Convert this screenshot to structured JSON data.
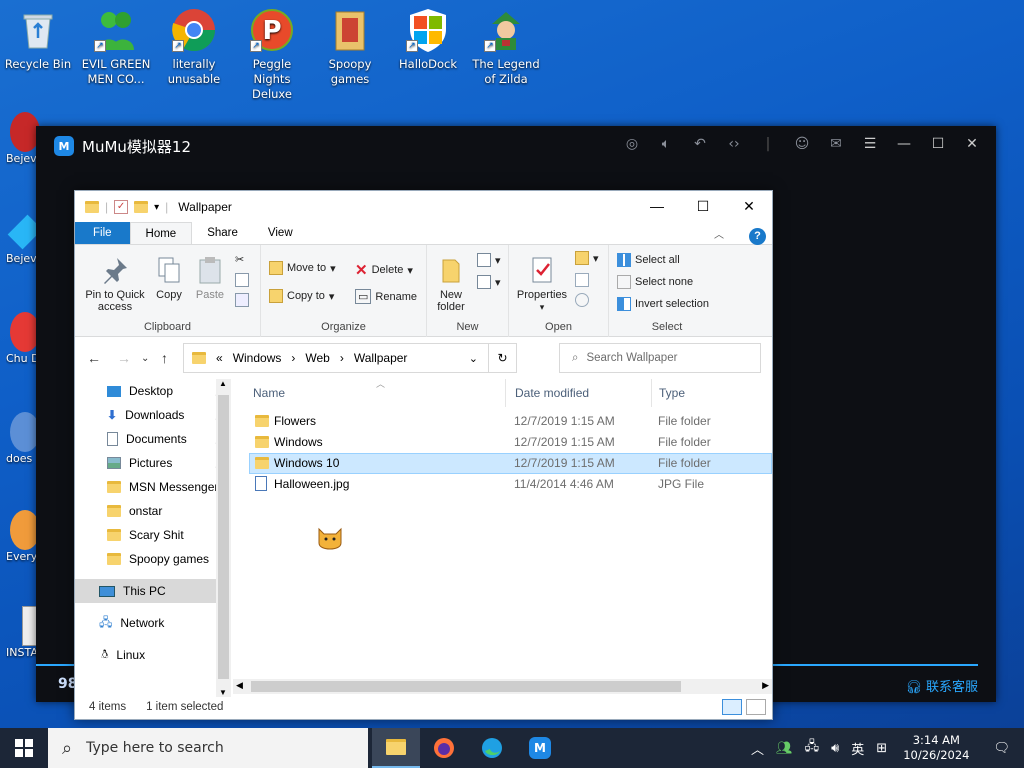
{
  "desktop": {
    "icons": [
      {
        "label": "Recycle Bin",
        "icon": "recycle-bin-icon"
      },
      {
        "label": "EVIL GREEN MEN CO...",
        "icon": "green-men-icon"
      },
      {
        "label": "literally unusable",
        "icon": "chrome-icon"
      },
      {
        "label": "Peggle Nights Deluxe",
        "icon": "peggle-icon"
      },
      {
        "label": "Spoopy games",
        "icon": "folder-icon"
      },
      {
        "label": "HalloDock",
        "icon": "windows-shield-icon"
      },
      {
        "label": "The Legend of Zilda",
        "icon": "zelda-icon"
      }
    ],
    "side_labels": [
      "Bejev Del",
      "Bejev Del",
      "Chu Del",
      "does",
      "Every",
      "INSTA"
    ]
  },
  "mumu": {
    "title": "MuMu模拟器12",
    "bottom_text": "98",
    "support_text": "联系客服"
  },
  "explorer": {
    "title": "Wallpaper",
    "tabs": {
      "file": "File",
      "home": "Home",
      "share": "Share",
      "view": "View"
    },
    "ribbon": {
      "pin_label": "Pin to Quick access",
      "copy_label": "Copy",
      "paste_label": "Paste",
      "clipboard_group": "Clipboard",
      "move_to": "Move to",
      "copy_to": "Copy to",
      "delete": "Delete",
      "rename": "Rename",
      "organize_group": "Organize",
      "new_folder": "New folder",
      "new_group": "New",
      "properties": "Properties",
      "open_group": "Open",
      "select_all": "Select all",
      "select_none": "Select none",
      "invert_selection": "Invert selection",
      "select_group": "Select"
    },
    "address": {
      "chevron": "«",
      "crumbs": [
        "Windows",
        "Web",
        "Wallpaper"
      ],
      "search_placeholder": "Search Wallpaper"
    },
    "nav": [
      {
        "label": "Desktop",
        "pinned": true,
        "icon": "desktop-icon"
      },
      {
        "label": "Downloads",
        "pinned": true,
        "icon": "download-icon"
      },
      {
        "label": "Documents",
        "pinned": true,
        "icon": "documents-icon"
      },
      {
        "label": "Pictures",
        "pinned": true,
        "icon": "pictures-icon"
      },
      {
        "label": "MSN Messenger",
        "pinned": false,
        "icon": "folder-icon"
      },
      {
        "label": "onstar",
        "pinned": false,
        "icon": "folder-icon"
      },
      {
        "label": "Scary Shit",
        "pinned": false,
        "icon": "folder-icon"
      },
      {
        "label": "Spoopy games",
        "pinned": false,
        "icon": "folder-icon"
      },
      {
        "label": "This PC",
        "pinned": false,
        "icon": "computer-icon"
      },
      {
        "label": "Network",
        "pinned": false,
        "icon": "network-icon"
      },
      {
        "label": "Linux",
        "pinned": false,
        "icon": "linux-icon"
      }
    ],
    "columns": {
      "name": "Name",
      "date": "Date modified",
      "type": "Type"
    },
    "files": [
      {
        "name": "Flowers",
        "date": "12/7/2019 1:15 AM",
        "type": "File folder",
        "selected": false
      },
      {
        "name": "Windows",
        "date": "12/7/2019 1:15 AM",
        "type": "File folder",
        "selected": false
      },
      {
        "name": "Windows 10",
        "date": "12/7/2019 1:15 AM",
        "type": "File folder",
        "selected": true
      },
      {
        "name": "Halloween.jpg",
        "date": "11/4/2014 4:46 AM",
        "type": "JPG File",
        "selected": false
      }
    ],
    "status": {
      "count": "4 items",
      "selection": "1 item selected"
    }
  },
  "taskbar": {
    "search_placeholder": "Type here to search",
    "apps": [
      "file-explorer-icon",
      "firefox-icon",
      "edge-icon",
      "mumu-icon"
    ],
    "ime": "英",
    "time": "3:14 AM",
    "date": "10/26/2024"
  }
}
